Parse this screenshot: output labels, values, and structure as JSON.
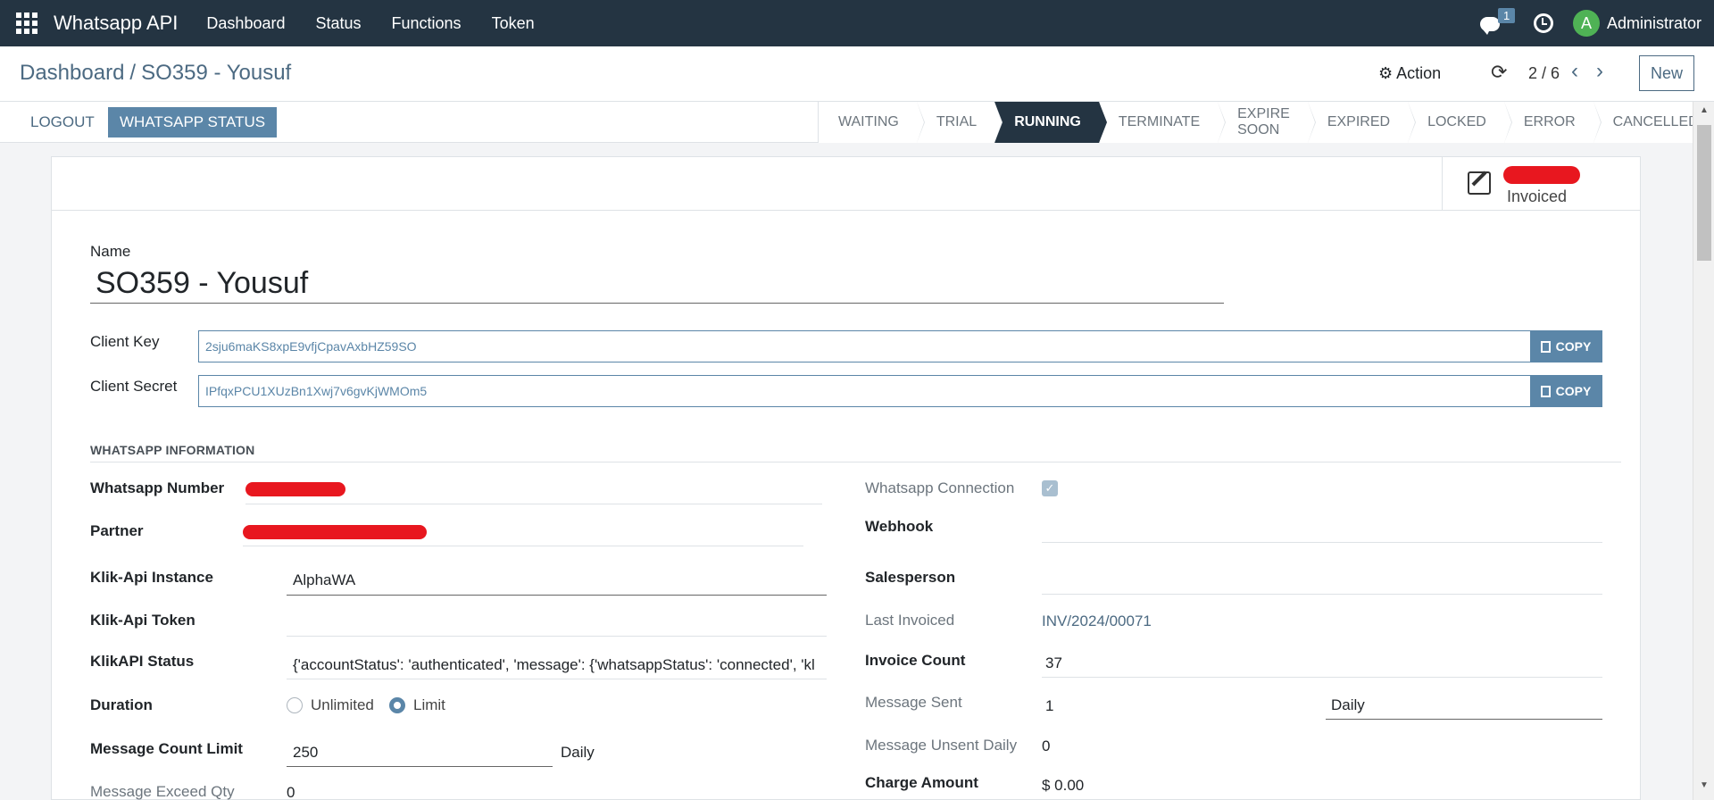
{
  "navbar": {
    "brand": "Whatsapp API",
    "menu": [
      "Dashboard",
      "Status",
      "Functions",
      "Token"
    ],
    "chat_count": "1",
    "avatar_letter": "A",
    "user": "Administrator"
  },
  "control": {
    "breadcrumb_parent": "Dashboard",
    "breadcrumb_sep": "/",
    "breadcrumb_current": "SO359 - Yousuf",
    "action_label": "Action",
    "pager": "2 / 6",
    "new_label": "New"
  },
  "statusbar": {
    "logout_label": "LOGOUT",
    "wa_status_label": "WHATSAPP STATUS",
    "stages": [
      "WAITING",
      "TRIAL",
      "RUNNING",
      "TERMINATE",
      "EXPIRE SOON",
      "EXPIRED",
      "LOCKED",
      "ERROR",
      "CANCELLED"
    ],
    "active_stage": "RUNNING"
  },
  "form": {
    "stat_label": "Invoiced",
    "name_label": "Name",
    "name_value": "SO359 - Yousuf",
    "client_key_label": "Client Key",
    "client_key_value": "2sju6maKS8xpE9vfjCpavAxbHZ59SO",
    "client_secret_label": "Client Secret",
    "client_secret_value": "IPfqxPCU1XUzBn1Xwj7v6gvKjWMOm5",
    "copy_label": "COPY",
    "section_title": "WHATSAPP INFORMATION",
    "left": {
      "wa_number_label": "Whatsapp Number",
      "partner_label": "Partner",
      "instance_label": "Klik-Api Instance",
      "instance_value": "AlphaWA",
      "token_label": "Klik-Api Token",
      "status_label": "KlikAPI Status",
      "status_value": "{'accountStatus': 'authenticated', 'message': {'whatsappStatus': 'connected', 'kl",
      "duration_label": "Duration",
      "duration_opt1": "Unlimited",
      "duration_opt2": "Limit",
      "duration_selected": "Limit",
      "msg_limit_label": "Message Count Limit",
      "msg_limit_value": "250",
      "msg_limit_unit": "Daily",
      "exceed_label": "Message Exceed Qty",
      "exceed_value": "0"
    },
    "right": {
      "connection_label": "Whatsapp Connection",
      "connection_checked": true,
      "webhook_label": "Webhook",
      "salesperson_label": "Salesperson",
      "last_invoiced_label": "Last Invoiced",
      "last_invoiced_value": "INV/2024/00071",
      "invoice_count_label": "Invoice Count",
      "invoice_count_value": "37",
      "msg_sent_label": "Message Sent",
      "msg_sent_value": "1",
      "msg_sent_period": "Daily",
      "unsent_label": "Message Unsent Daily",
      "unsent_value": "0",
      "charge_label": "Charge Amount",
      "charge_value": "$ 0.00"
    }
  },
  "colors": {
    "navbar": "#243442",
    "accent": "#5b86a8",
    "redaction": "#e8171f"
  }
}
